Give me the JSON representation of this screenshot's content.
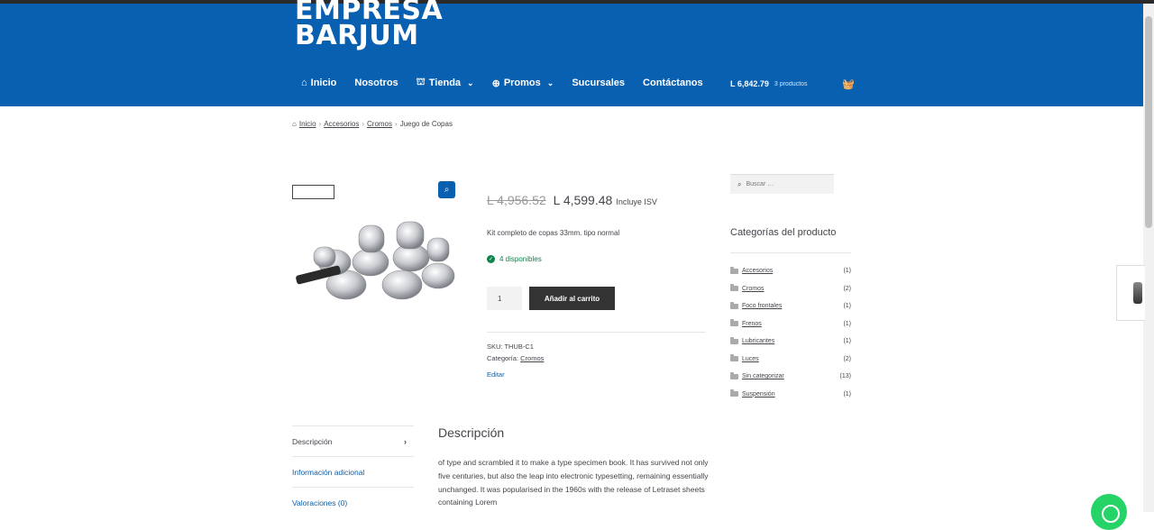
{
  "header": {
    "logo_line1": "EMPRESA",
    "logo_line2": "BARJUM",
    "nav": [
      {
        "label": "Inicio",
        "icon": "home-icon"
      },
      {
        "label": "Nosotros"
      },
      {
        "label": "Tienda",
        "icon": "store-icon",
        "dropdown": true
      },
      {
        "label": "Promos",
        "icon": "plus-circle-icon",
        "dropdown": true
      },
      {
        "label": "Sucursales"
      },
      {
        "label": "Contáctanos"
      }
    ],
    "cart_amount": "L 6,842.79",
    "cart_count": "3 productos"
  },
  "breadcrumb": {
    "items": [
      "Inicio",
      "Accesorios",
      "Cromos"
    ],
    "current": "Juego de Copas"
  },
  "product": {
    "old_price": "L 4,956.52",
    "new_price": "L 4,599.48",
    "tax_note": "Incluye ISV",
    "short_description": "Kit completo de copas 33mm. tipo normal",
    "stock": "4 disponibles",
    "quantity": "1",
    "add_to_cart": "Añadir al carrito",
    "sku_label": "SKU:",
    "sku": "THUB-C1",
    "category_label": "Categoría:",
    "category": "Cromos",
    "edit": "Editar"
  },
  "sidebar": {
    "search_placeholder": "Buscar …",
    "categories_title": "Categorías del producto",
    "categories": [
      {
        "name": "Accesorios",
        "count": "(1)"
      },
      {
        "name": "Cromos",
        "count": "(2)"
      },
      {
        "name": "Foco frontales",
        "count": "(1)"
      },
      {
        "name": "Frenos",
        "count": "(1)"
      },
      {
        "name": "Lubricantes",
        "count": "(1)"
      },
      {
        "name": "Luces",
        "count": "(2)"
      },
      {
        "name": "Sin categorizar",
        "count": "(13)"
      },
      {
        "name": "Suspensión",
        "count": "(1)"
      }
    ]
  },
  "tabs": [
    {
      "label": "Descripción",
      "active": true
    },
    {
      "label": "Información adicional"
    },
    {
      "label": "Valoraciones (0)"
    }
  ],
  "description": {
    "title": "Descripción",
    "body": "of type and scrambled it to make a type specimen book. It has survived not only five centuries, but also the leap into electronic typesetting, remaining essentially unchanged. It was popularised in the 1960s with the release of Letraset sheets containing Lorem"
  },
  "colors": {
    "brand": "#0960b0",
    "stock": "#0f834d",
    "button": "#333333"
  }
}
